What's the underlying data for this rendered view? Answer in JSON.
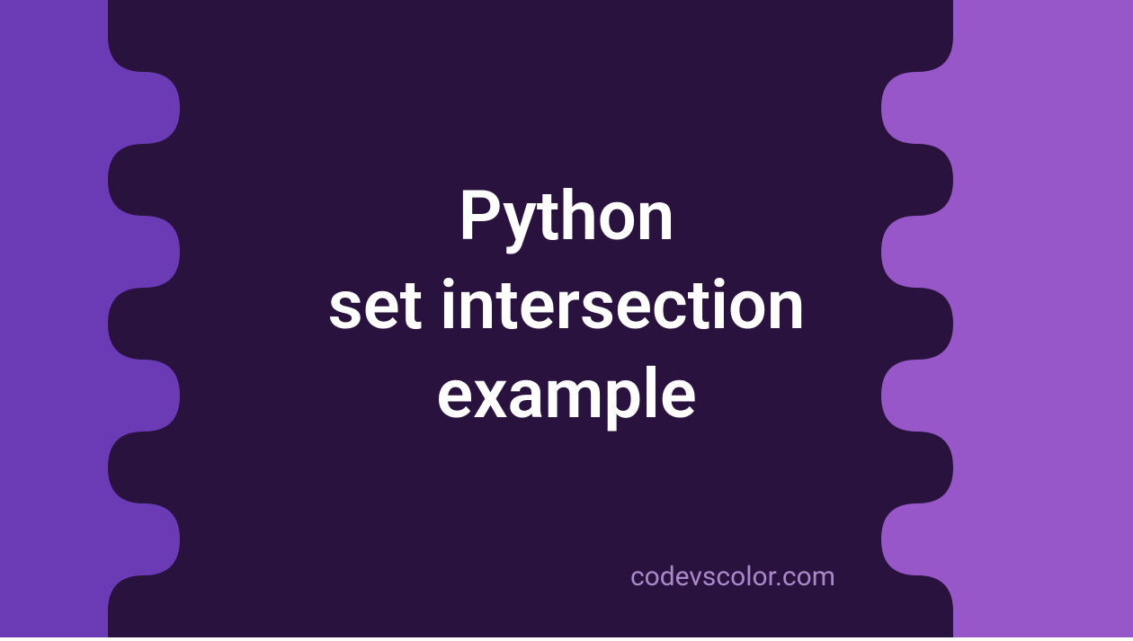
{
  "title_line1": "Python",
  "title_line2": "set intersection",
  "title_line3": "example",
  "attribution": "codevscolor.com",
  "colors": {
    "bg_left": "#6a3bb5",
    "bg_right": "#9757c8",
    "blob": "#2a123f",
    "text": "#ffffff",
    "attribution_text": "#a989c9"
  }
}
